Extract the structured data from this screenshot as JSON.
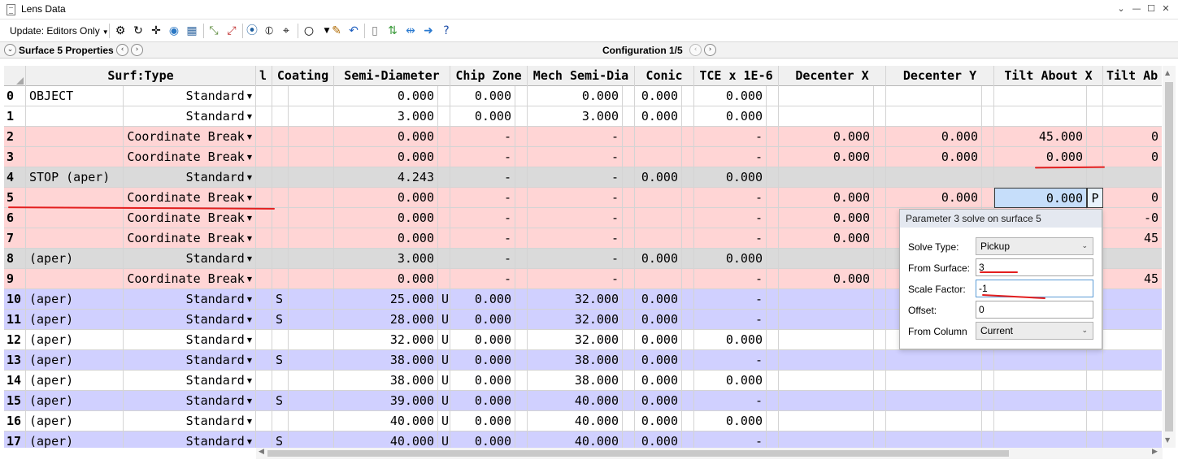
{
  "window": {
    "title": "Lens Data",
    "controls": [
      "⌄",
      "—",
      "☐",
      "✕"
    ]
  },
  "toolbar": {
    "update_label": "Update: Editors Only",
    "icons": [
      "settings-icon",
      "refresh-icon",
      "crosshair-icon",
      "globe-icon",
      "map-icon",
      "select-all-icon",
      "deselect-icon",
      "circle-dot-icon",
      "lens-icon",
      "aperture-icon",
      "circle-icon",
      "edit-icon",
      "undo-icon",
      "page-icon",
      "sync-icon",
      "arrows-icon",
      "arrow-right-icon",
      "help-icon"
    ]
  },
  "props": {
    "surface_label": "Surface 5 Properties",
    "config_label": "Configuration 1/5"
  },
  "grid": {
    "headers": {
      "surf_type": "Surf:Type",
      "comment": "l",
      "coating": "Coating",
      "semi_diameter": "Semi-Diameter",
      "chip_zone": "Chip Zone",
      "mech_semi_dia": "Mech Semi-Dia",
      "conic": "Conic",
      "tce": "TCE x 1E-6",
      "decenter_x": "Decenter X",
      "decenter_y": "Decenter Y",
      "tilt_x": "Tilt About X",
      "tilt_y": "Tilt Ab"
    },
    "rows": [
      {
        "num": "0",
        "color": "white",
        "name": "OBJECT",
        "type": "Standard",
        "coat": "",
        "semi": "0.000",
        "semi_s": "",
        "chip": "0.000",
        "mech": "0.000",
        "conic": "0.000",
        "tce": "0.000",
        "dx": "",
        "dy": "",
        "tx": "",
        "ty": ""
      },
      {
        "num": "1",
        "color": "white",
        "name": "",
        "type": "Standard",
        "coat": "",
        "semi": "3.000",
        "semi_s": "",
        "chip": "0.000",
        "mech": "3.000",
        "conic": "0.000",
        "tce": "0.000",
        "dx": "",
        "dy": "",
        "tx": "",
        "ty": ""
      },
      {
        "num": "2",
        "color": "pink",
        "name": "",
        "type": "Coordinate Break",
        "coat": "",
        "semi": "0.000",
        "semi_s": "",
        "chip": "-",
        "mech": "-",
        "conic": "",
        "tce": "-",
        "dx": "0.000",
        "dy": "0.000",
        "tx": "45.000",
        "ty": "0"
      },
      {
        "num": "3",
        "color": "pink",
        "name": "",
        "type": "Coordinate Break",
        "coat": "",
        "semi": "0.000",
        "semi_s": "",
        "chip": "-",
        "mech": "-",
        "conic": "",
        "tce": "-",
        "dx": "0.000",
        "dy": "0.000",
        "tx": "0.000",
        "ty": "0"
      },
      {
        "num": "4",
        "color": "gray",
        "name": "STOP (aper)",
        "type": "Standard",
        "coat": "",
        "semi": "4.243",
        "semi_s": "",
        "chip": "-",
        "mech": "-",
        "conic": "0.000",
        "tce": "0.000",
        "dx": "",
        "dy": "",
        "tx": "",
        "ty": ""
      },
      {
        "num": "5",
        "color": "pink",
        "name": "",
        "type": "Coordinate Break",
        "coat": "",
        "semi": "0.000",
        "semi_s": "",
        "chip": "-",
        "mech": "-",
        "conic": "",
        "tce": "-",
        "dx": "0.000",
        "dy": "0.000",
        "tx": "0.000",
        "tx_solve": "P",
        "ty": "0"
      },
      {
        "num": "6",
        "color": "pink",
        "name": "",
        "type": "Coordinate Break",
        "coat": "",
        "semi": "0.000",
        "semi_s": "",
        "chip": "-",
        "mech": "-",
        "conic": "",
        "tce": "-",
        "dx": "0.000",
        "dy": "",
        "tx": "",
        "ty": "-0"
      },
      {
        "num": "7",
        "color": "pink",
        "name": "",
        "type": "Coordinate Break",
        "coat": "",
        "semi": "0.000",
        "semi_s": "",
        "chip": "-",
        "mech": "-",
        "conic": "",
        "tce": "-",
        "dx": "0.000",
        "dy": "",
        "tx": "",
        "ty": "45"
      },
      {
        "num": "8",
        "color": "gray",
        "name": "(aper)",
        "type": "Standard",
        "coat": "",
        "semi": "3.000",
        "semi_s": "",
        "chip": "-",
        "mech": "-",
        "conic": "0.000",
        "tce": "0.000",
        "dx": "",
        "dy": "",
        "tx": "",
        "ty": ""
      },
      {
        "num": "9",
        "color": "pink",
        "name": "",
        "type": "Coordinate Break",
        "coat": "",
        "semi": "0.000",
        "semi_s": "",
        "chip": "-",
        "mech": "-",
        "conic": "",
        "tce": "-",
        "dx": "0.000",
        "dy": "",
        "tx": "",
        "ty": "45"
      },
      {
        "num": "10",
        "color": "blue",
        "name": "(aper)",
        "type": "Standard",
        "coat": "S",
        "semi": "25.000",
        "semi_s": "U",
        "chip": "0.000",
        "mech": "32.000",
        "conic": "0.000",
        "tce": "-",
        "dx": "",
        "dy": "",
        "tx": "",
        "ty": ""
      },
      {
        "num": "11",
        "color": "blue",
        "name": "(aper)",
        "type": "Standard",
        "coat": "S",
        "semi": "28.000",
        "semi_s": "U",
        "chip": "0.000",
        "mech": "32.000",
        "conic": "0.000",
        "tce": "-",
        "dx": "",
        "dy": "",
        "tx": "",
        "ty": ""
      },
      {
        "num": "12",
        "color": "white",
        "name": "(aper)",
        "type": "Standard",
        "coat": "",
        "semi": "32.000",
        "semi_s": "U",
        "chip": "0.000",
        "mech": "32.000",
        "conic": "0.000",
        "tce": "0.000",
        "dx": "",
        "dy": "",
        "tx": "",
        "ty": ""
      },
      {
        "num": "13",
        "color": "blue",
        "name": "(aper)",
        "type": "Standard",
        "coat": "S",
        "semi": "38.000",
        "semi_s": "U",
        "chip": "0.000",
        "mech": "38.000",
        "conic": "0.000",
        "tce": "-",
        "dx": "",
        "dy": "",
        "tx": "",
        "ty": ""
      },
      {
        "num": "14",
        "color": "white",
        "name": "(aper)",
        "type": "Standard",
        "coat": "",
        "semi": "38.000",
        "semi_s": "U",
        "chip": "0.000",
        "mech": "38.000",
        "conic": "0.000",
        "tce": "0.000",
        "dx": "",
        "dy": "",
        "tx": "",
        "ty": ""
      },
      {
        "num": "15",
        "color": "blue",
        "name": "(aper)",
        "type": "Standard",
        "coat": "S",
        "semi": "39.000",
        "semi_s": "U",
        "chip": "0.000",
        "mech": "40.000",
        "conic": "0.000",
        "tce": "-",
        "dx": "",
        "dy": "",
        "tx": "",
        "ty": ""
      },
      {
        "num": "16",
        "color": "white",
        "name": "(aper)",
        "type": "Standard",
        "coat": "",
        "semi": "40.000",
        "semi_s": "U",
        "chip": "0.000",
        "mech": "40.000",
        "conic": "0.000",
        "tce": "0.000",
        "dx": "",
        "dy": "",
        "tx": "",
        "ty": ""
      },
      {
        "num": "17",
        "color": "blue",
        "name": "(aper)",
        "type": "Standard",
        "coat": "S",
        "semi": "40.000",
        "semi_s": "U",
        "chip": "0.000",
        "mech": "40.000",
        "conic": "0.000",
        "tce": "-",
        "dx": "",
        "dy": "",
        "tx": "",
        "ty": ""
      }
    ]
  },
  "popup": {
    "title": "Parameter 3 solve on surface 5",
    "solve_type_label": "Solve Type:",
    "solve_type_value": "Pickup",
    "from_surface_label": "From Surface:",
    "from_surface_value": "3",
    "scale_factor_label": "Scale Factor:",
    "scale_factor_value": "-1",
    "offset_label": "Offset:",
    "offset_value": "0",
    "from_column_label": "From Column",
    "from_column_value": "Current"
  },
  "colors": {
    "white_row": "#ffffff",
    "pink_row": "#ffd5d5",
    "gray_row": "#dadada",
    "blue_row": "#d0d0ff",
    "annotation": "#e31e1e"
  }
}
